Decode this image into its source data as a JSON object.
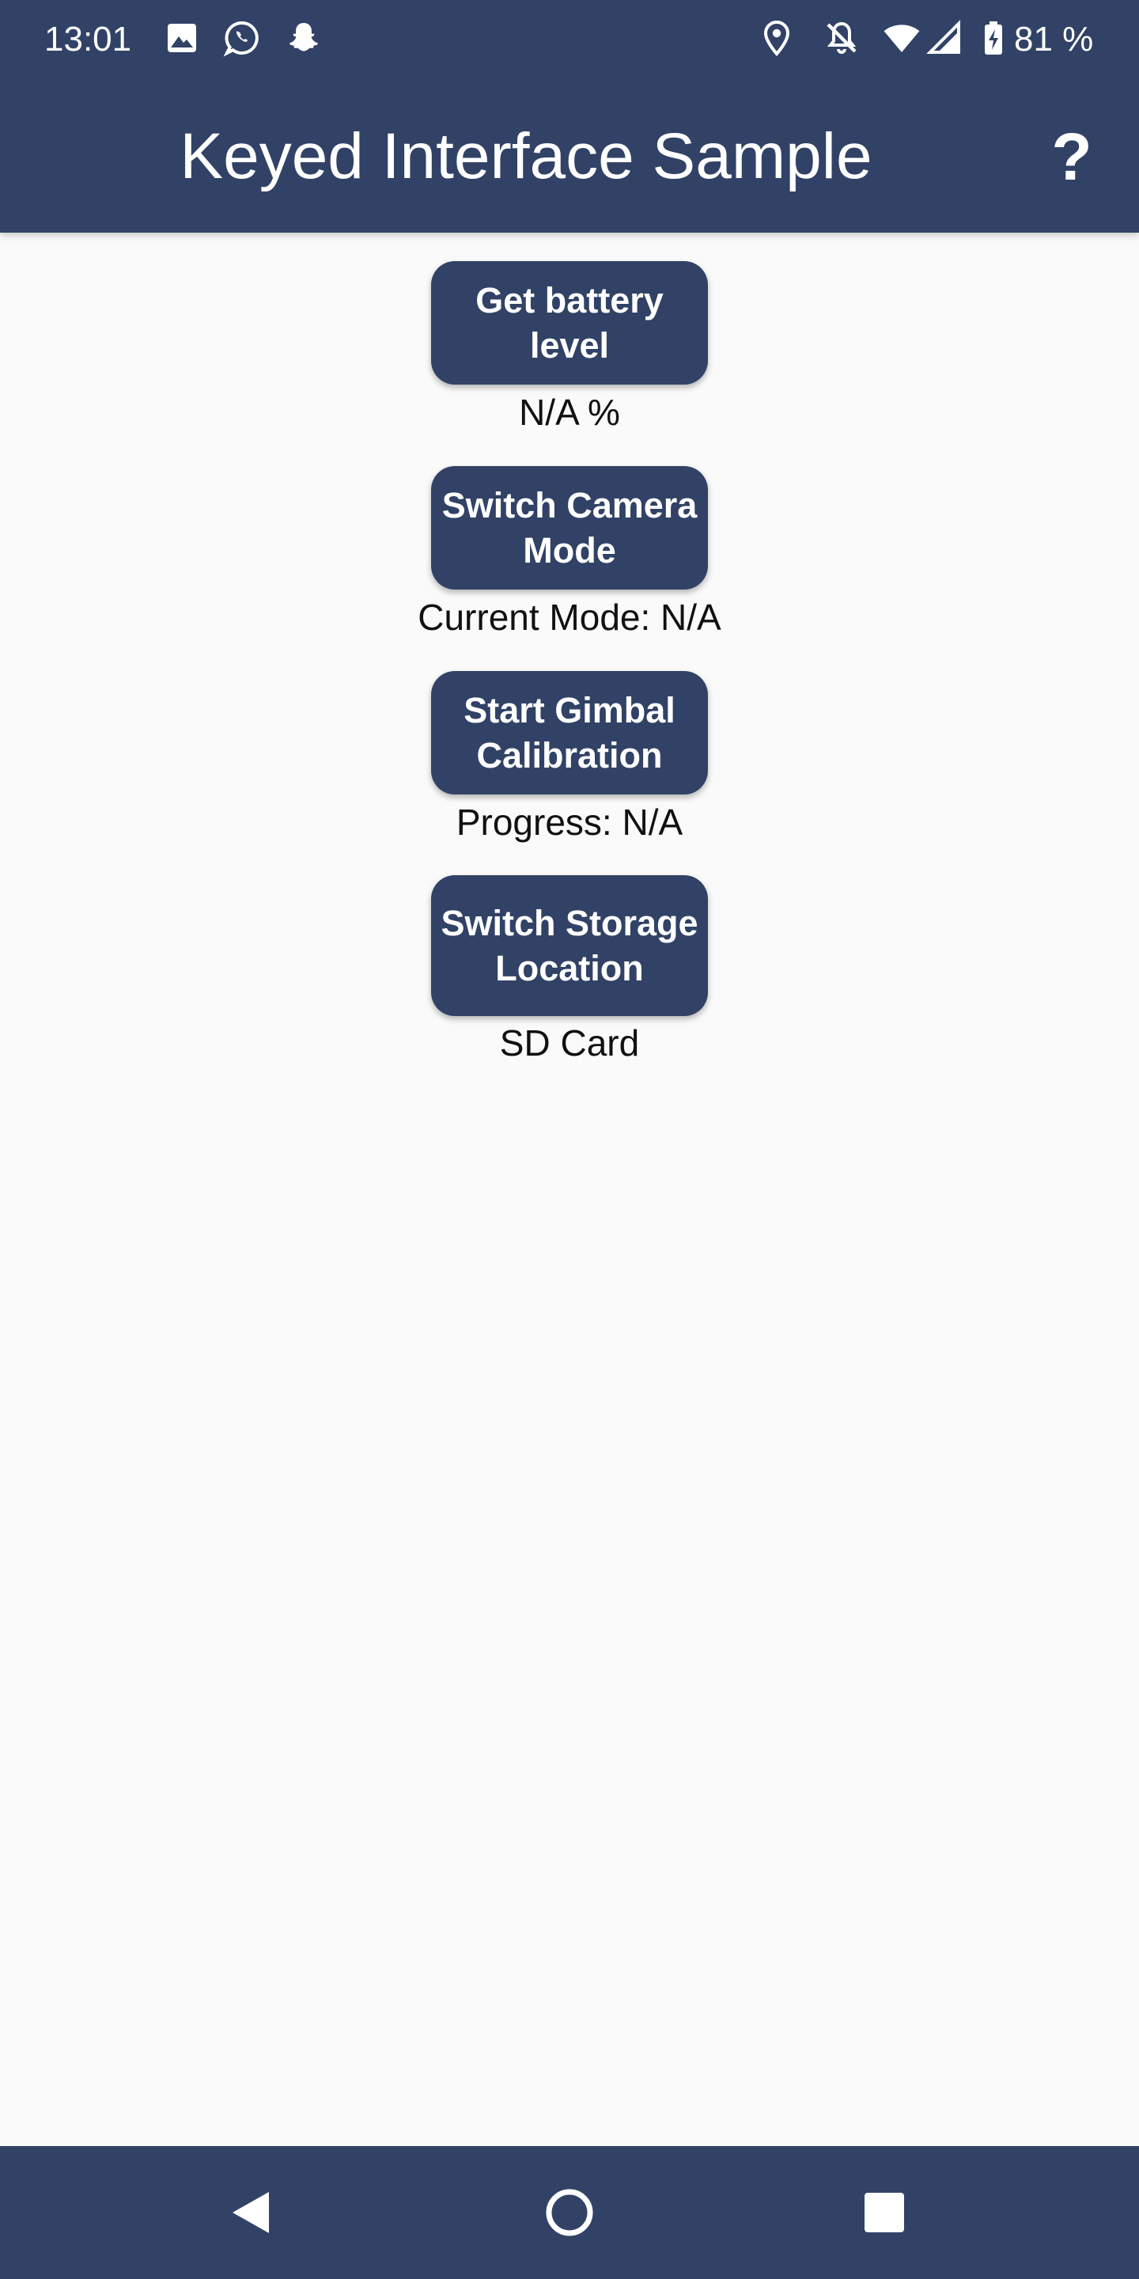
{
  "status_bar": {
    "time": "13:01",
    "battery_percent": "81 %",
    "left_icons": [
      "image-icon",
      "whatsapp-icon",
      "snapchat-icon"
    ],
    "right_icons": [
      "location-icon",
      "notifications-off-icon",
      "wifi-icon",
      "cell-signal-icon",
      "battery-charging-icon"
    ]
  },
  "app_bar": {
    "title": "Keyed Interface Sample",
    "help_label": "?"
  },
  "controls": {
    "battery_button": "Get battery level",
    "battery_value": "N/A %",
    "camera_button": "Switch Camera Mode",
    "camera_value": "Current Mode: N/A",
    "gimbal_button": "Start Gimbal Calibration",
    "gimbal_value": "Progress: N/A",
    "storage_button": "Switch Storage Location",
    "storage_value": "SD Card"
  },
  "nav_bar": {
    "icons": [
      "back-icon",
      "home-icon",
      "recents-icon"
    ]
  },
  "colors": {
    "primary": "#314266",
    "background": "#FAFAFA",
    "on_primary": "#FFFFFF",
    "text": "#111111"
  }
}
